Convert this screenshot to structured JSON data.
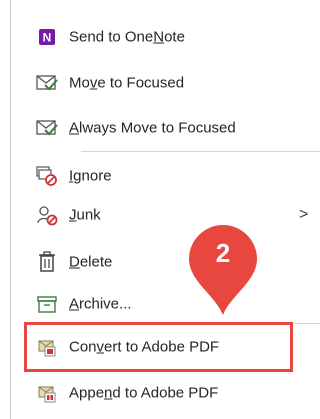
{
  "menu": {
    "items": [
      {
        "icon": "onenote-icon",
        "parts": [
          "Send to One",
          "N",
          "ote"
        ]
      },
      {
        "icon": "envelope-check-icon",
        "parts": [
          "Mo",
          "v",
          "e to Focused"
        ]
      },
      {
        "icon": "envelope-check-icon",
        "parts": [
          "",
          "A",
          "lways Move to Focused"
        ]
      },
      {
        "icon": "ignore-icon",
        "parts": [
          "",
          "I",
          "gnore"
        ]
      },
      {
        "icon": "junk-icon",
        "parts": [
          "",
          "J",
          "unk"
        ],
        "submenu_glyph": ">"
      },
      {
        "icon": "trash-icon",
        "parts": [
          "",
          "D",
          "elete"
        ]
      },
      {
        "icon": "archive-icon",
        "parts": [
          "",
          "A",
          "rchive..."
        ]
      },
      {
        "icon": "convert-pdf-icon",
        "parts": [
          "Con",
          "v",
          "ert to Adobe PDF"
        ]
      },
      {
        "icon": "append-pdf-icon",
        "parts": [
          "Appe",
          "n",
          "d to Adobe PDF"
        ]
      }
    ]
  },
  "annotation": {
    "number": "2",
    "color": "#e8473f"
  },
  "colors": {
    "onenote": "#7719aa",
    "icon_green": "#3a7d3a",
    "icon_red": "#d13438",
    "text": "#262626"
  }
}
